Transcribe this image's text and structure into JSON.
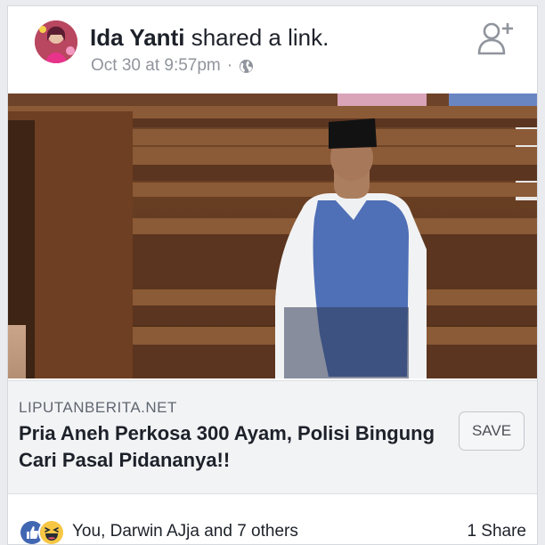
{
  "post": {
    "author": "Ida Yanti",
    "action": "shared a link.",
    "timestamp": "Oct 30 at 9:57pm",
    "separator": "·",
    "privacy_icon": "globe-icon",
    "follow_icon": "add-person-icon"
  },
  "link": {
    "domain": "LIPUTANBERITA.NET",
    "title": "Pria Aneh Perkosa 300 Ayam, Polisi Bingung Cari Pasal Pidananya!!",
    "save_label": "SAVE"
  },
  "engagement": {
    "reaction_icons": [
      "like-icon",
      "haha-icon"
    ],
    "reactions_text": "You, Darwin AJja and 7 others",
    "shares_text": "1 Share"
  },
  "colors": {
    "facebook_blue": "#4267b2",
    "haha_yellow": "#f7c744",
    "meta_gray": "#90949c",
    "link_panel_bg": "#f2f3f5"
  }
}
